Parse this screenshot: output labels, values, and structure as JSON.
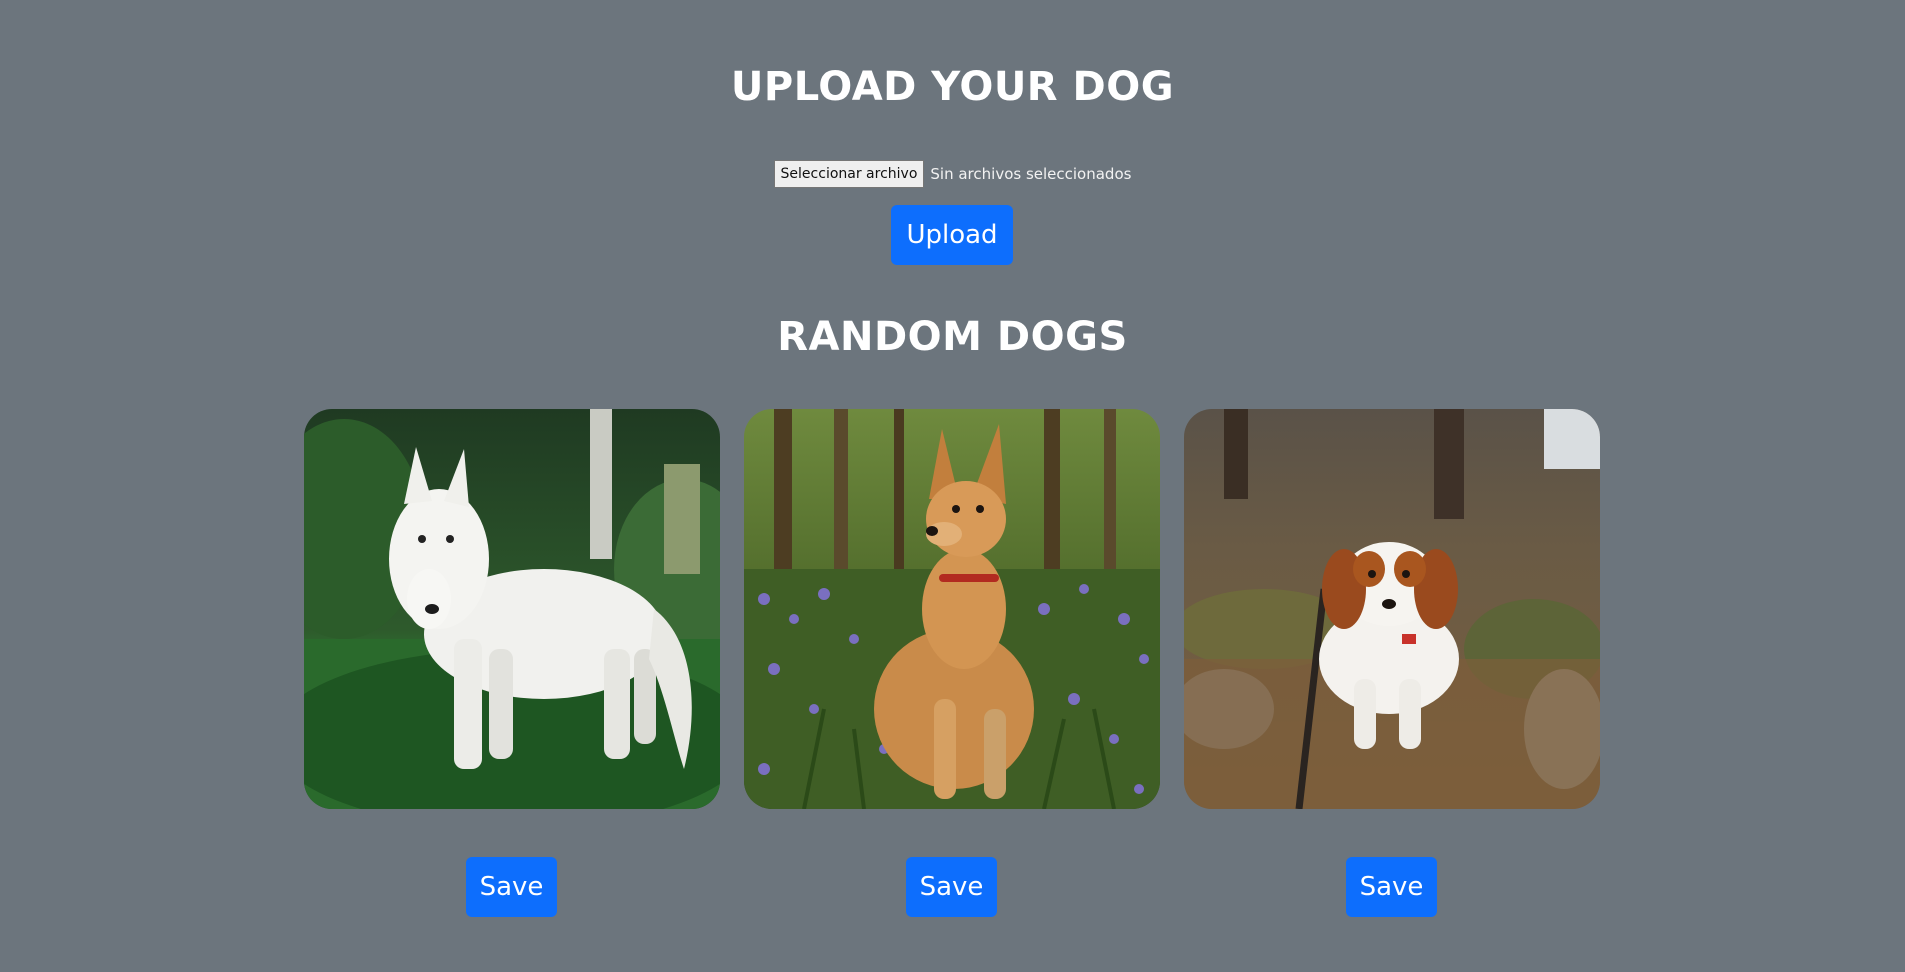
{
  "upload": {
    "title": "UPLOAD YOUR DOG",
    "file_button_label": "Seleccionar archivo",
    "file_status": "Sin archivos seleccionados",
    "submit_label": "Upload"
  },
  "random": {
    "title": "RANDOM DOGS",
    "cards": [
      {
        "image": "white-shepherd-dog-photo",
        "save_label": "Save"
      },
      {
        "image": "tan-puppy-in-bluebells-photo",
        "save_label": "Save"
      },
      {
        "image": "spaniel-on-forest-floor-photo",
        "save_label": "Save"
      }
    ]
  },
  "colors": {
    "background": "#6c757d",
    "primary": "#0d6efd",
    "text": "#ffffff"
  }
}
